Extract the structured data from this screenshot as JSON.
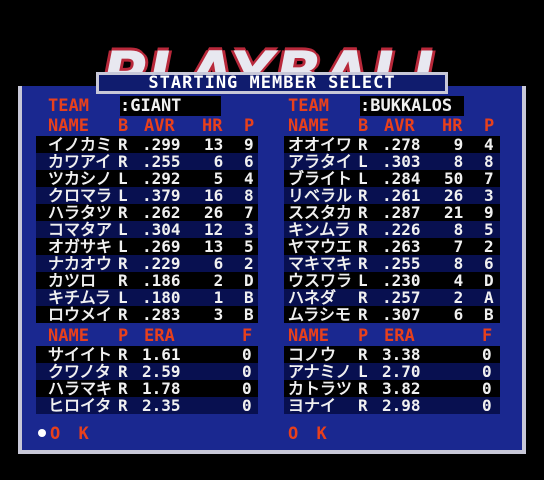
{
  "logo_text": "PLAYBALL III",
  "title": "STARTING MEMBER  SELECT",
  "labels": {
    "team": "TEAM",
    "name": "NAME",
    "b": "B",
    "avr": "AVR",
    "hr": "HR",
    "p": "P",
    "era": "ERA",
    "f": "F",
    "ok": "O K"
  },
  "left": {
    "team": ":GIANT",
    "batters": [
      {
        "name": "イノカミ",
        "b": "R",
        "avr": ".299",
        "hr": "13",
        "p": "9"
      },
      {
        "name": "カワアイ",
        "b": "R",
        "avr": ".255",
        "hr": "6",
        "p": "6"
      },
      {
        "name": "ツカシノ",
        "b": "L",
        "avr": ".292",
        "hr": "5",
        "p": "4"
      },
      {
        "name": "クロマラ",
        "b": "L",
        "avr": ".379",
        "hr": "16",
        "p": "8"
      },
      {
        "name": "ハラタツ",
        "b": "R",
        "avr": ".262",
        "hr": "26",
        "p": "7"
      },
      {
        "name": "コマタア",
        "b": "L",
        "avr": ".304",
        "hr": "12",
        "p": "3"
      },
      {
        "name": "オガサキ",
        "b": "L",
        "avr": ".269",
        "hr": "13",
        "p": "5"
      },
      {
        "name": "ナカオウ",
        "b": "R",
        "avr": ".229",
        "hr": "6",
        "p": "2"
      },
      {
        "name": "カツロ",
        "b": "R",
        "avr": ".186",
        "hr": "2",
        "p": "D"
      },
      {
        "name": "キチムラ",
        "b": "L",
        "avr": ".180",
        "hr": "1",
        "p": "B"
      },
      {
        "name": "ロウメイ",
        "b": "R",
        "avr": ".283",
        "hr": "3",
        "p": "B"
      }
    ],
    "pitchers": [
      {
        "name": "サイイト",
        "p": "R",
        "era": "1.61",
        "f": "0"
      },
      {
        "name": "クワノタ",
        "p": "R",
        "era": "2.59",
        "f": "0"
      },
      {
        "name": "ハラマキ",
        "p": "R",
        "era": "1.78",
        "f": "0"
      },
      {
        "name": "ヒロイタ",
        "p": "R",
        "era": "2.35",
        "f": "0"
      }
    ]
  },
  "right": {
    "team": ":BUKKALOS",
    "batters": [
      {
        "name": "オオイワ",
        "b": "R",
        "avr": ".278",
        "hr": "9",
        "p": "4"
      },
      {
        "name": "アラタイ",
        "b": "L",
        "avr": ".303",
        "hr": "8",
        "p": "8"
      },
      {
        "name": "ブライト",
        "b": "L",
        "avr": ".284",
        "hr": "50",
        "p": "7"
      },
      {
        "name": "リベラル",
        "b": "R",
        "avr": ".261",
        "hr": "26",
        "p": "3"
      },
      {
        "name": "ススタカ",
        "b": "R",
        "avr": ".287",
        "hr": "21",
        "p": "9"
      },
      {
        "name": "キンムラ",
        "b": "R",
        "avr": ".226",
        "hr": "8",
        "p": "5"
      },
      {
        "name": "ヤマウエ",
        "b": "R",
        "avr": ".263",
        "hr": "7",
        "p": "2"
      },
      {
        "name": "マキマキ",
        "b": "R",
        "avr": ".255",
        "hr": "8",
        "p": "6"
      },
      {
        "name": "ウスワラ",
        "b": "L",
        "avr": ".230",
        "hr": "4",
        "p": "D"
      },
      {
        "name": "ハネダ",
        "b": "R",
        "avr": ".257",
        "hr": "2",
        "p": "A"
      },
      {
        "name": "ムラシモ",
        "b": "R",
        "avr": ".307",
        "hr": "6",
        "p": "B"
      }
    ],
    "pitchers": [
      {
        "name": "コノウ",
        "p": "R",
        "era": "3.38",
        "f": "0"
      },
      {
        "name": "アナミノ",
        "p": "L",
        "era": "2.70",
        "f": "0"
      },
      {
        "name": "カトラツ",
        "p": "R",
        "era": "3.82",
        "f": "0"
      },
      {
        "name": "ヨナイ",
        "p": "R",
        "era": "2.98",
        "f": "0"
      }
    ]
  }
}
